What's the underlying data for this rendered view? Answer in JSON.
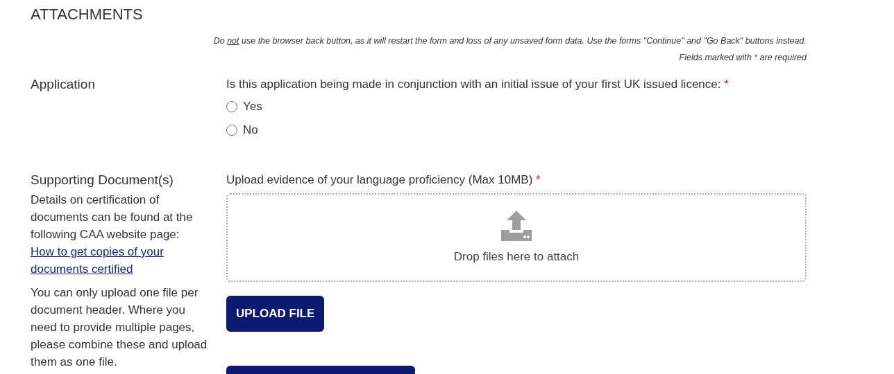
{
  "heading": "ATTACHMENTS",
  "notice": {
    "before": "Do ",
    "underlined": "not",
    "after": " use the browser back button, as it will restart the form and loss of any unsaved form data. Use the forms \"Continue\" and \"Go Back\" buttons instead."
  },
  "required_note": {
    "before": "Fields marked with ",
    "marker": "*",
    "after": " are required"
  },
  "sections": [
    {
      "kind": "radio",
      "title": "Application",
      "question": "Is this application being made in conjunction with an initial issue of your first UK issued licence:",
      "required_marker": "*",
      "options": [
        {
          "label": "Yes",
          "selected": false
        },
        {
          "label": "No",
          "selected": false
        }
      ]
    },
    {
      "kind": "upload",
      "title": "Supporting Document(s)",
      "description": "Details on certification of documents can be found at the following CAA website page:",
      "link": "How to get copies of your documents certified",
      "note": "You can only upload one file per document header. Where you need to provide multiple pages, please combine these and upload them as one file.",
      "question": "Upload evidence of your language proficiency (Max 10MB)",
      "required_marker": "*",
      "dropzone": "Drop files here to attach",
      "button": "UPLOAD FILE"
    }
  ]
}
